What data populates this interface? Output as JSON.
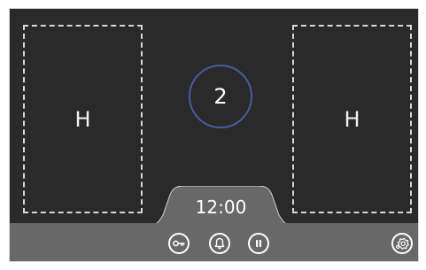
{
  "cooktop": {
    "zones": [
      {
        "label": "H"
      },
      {
        "label": "H"
      }
    ],
    "center_indicator": {
      "value": "2"
    },
    "timer": {
      "time": "12:00"
    },
    "toolbar": {
      "icons": {
        "key": "key-icon",
        "bell": "bell-icon",
        "pause": "pause-icon",
        "settings": "settings-icon"
      }
    }
  }
}
